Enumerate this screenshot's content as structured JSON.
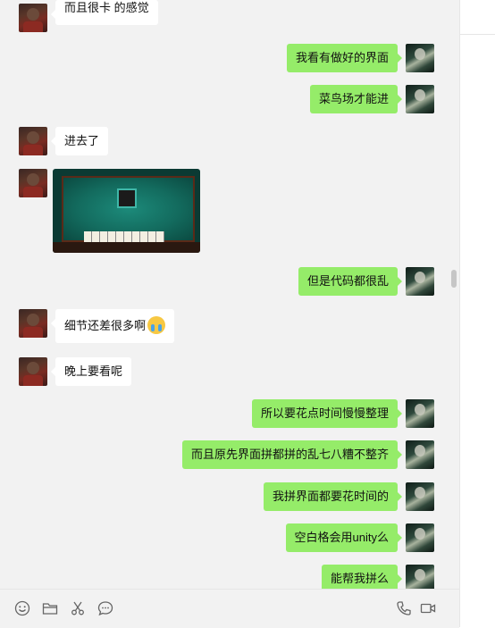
{
  "chat": {
    "messages": [
      {
        "side": "left",
        "type": "text",
        "text": "而且很卡 的感觉"
      },
      {
        "side": "right",
        "type": "text",
        "text": "我看有做好的界面"
      },
      {
        "side": "right",
        "type": "text",
        "text": "菜鸟场才能进"
      },
      {
        "side": "left",
        "type": "text",
        "text": "进去了"
      },
      {
        "side": "left",
        "type": "image",
        "text": ""
      },
      {
        "side": "right",
        "type": "text",
        "text": "但是代码都很乱"
      },
      {
        "side": "left",
        "type": "text",
        "text": "细节还差很多啊",
        "emoji": "crying-face-emoji"
      },
      {
        "side": "left",
        "type": "text",
        "text": "晚上要看呢"
      },
      {
        "side": "right",
        "type": "text",
        "text": "所以要花点时间慢慢整理"
      },
      {
        "side": "right",
        "type": "text",
        "text": "而且原先界面拼都拼的乱七八糟不整齐"
      },
      {
        "side": "right",
        "type": "text",
        "text": "我拼界面都要花时间的"
      },
      {
        "side": "right",
        "type": "text",
        "text": "空白格会用unity么"
      },
      {
        "side": "right",
        "type": "text",
        "text": "能帮我拼么"
      }
    ]
  },
  "toolbar": {
    "icons": [
      "emoji-icon",
      "folder-icon",
      "scissors-icon",
      "chat-bubble-icon",
      "phone-icon",
      "video-icon"
    ]
  },
  "colors": {
    "bubble_sent": "#95ec69",
    "bubble_received": "#ffffff",
    "chat_bg": "#f2f2f2"
  }
}
